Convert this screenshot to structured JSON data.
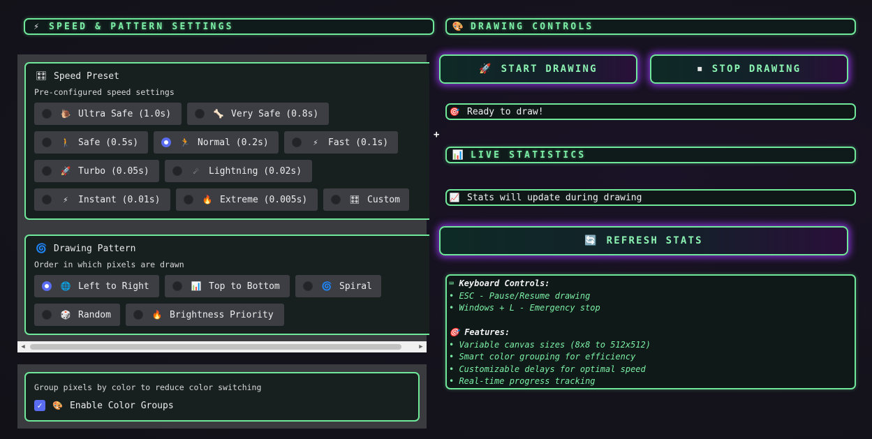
{
  "left_header": {
    "icon": "lightning-icon",
    "title": "SPEED & PATTERN SETTINGS"
  },
  "right_header": {
    "icon": "palette-icon",
    "title": "DRAWING CONTROLS"
  },
  "speed_preset": {
    "icon": "dice-icon",
    "title": "Speed Preset",
    "description": "Pre-configured speed settings",
    "selected": "Normal (0.2s)",
    "options": [
      {
        "label": "Ultra Safe (1.0s)",
        "icon": "snail-icon",
        "glyph": "🐌"
      },
      {
        "label": "Very Safe (0.8s)",
        "icon": "bone-icon",
        "glyph": "🦴"
      },
      {
        "label": "Safe (0.5s)",
        "icon": "walking-icon",
        "glyph": "🚶"
      },
      {
        "label": "Normal (0.2s)",
        "icon": "running-icon",
        "glyph": "🏃"
      },
      {
        "label": "Fast (0.1s)",
        "icon": "lightning-icon",
        "glyph": "⚡"
      },
      {
        "label": "Turbo (0.05s)",
        "icon": "rocket-icon",
        "glyph": "🚀"
      },
      {
        "label": "Lightning (0.02s)",
        "icon": "comet-icon",
        "glyph": "☄"
      },
      {
        "label": "Instant (0.01s)",
        "icon": "lightning-icon",
        "glyph": "⚡"
      },
      {
        "label": "Extreme (0.005s)",
        "icon": "fire-icon",
        "glyph": "🔥"
      },
      {
        "label": "Custom",
        "icon": "dice-icon",
        "glyph": "🎛"
      }
    ]
  },
  "drawing_pattern": {
    "icon": "spiral-icon",
    "title": "Drawing Pattern",
    "description": "Order in which pixels are drawn",
    "selected": "Left to Right",
    "options": [
      {
        "label": "Left to Right",
        "icon": "globe-icon",
        "glyph": "🌐"
      },
      {
        "label": "Top to Bottom",
        "icon": "bar-chart-icon",
        "glyph": "📊"
      },
      {
        "label": "Spiral",
        "icon": "spiral-icon",
        "glyph": "🌀"
      },
      {
        "label": "Random",
        "icon": "dice-icon",
        "glyph": "🎲"
      },
      {
        "label": "Brightness Priority",
        "icon": "fire-icon",
        "glyph": "🔥"
      }
    ]
  },
  "color_groups": {
    "description": "Group pixels by color to reduce color switching",
    "checkbox_label": "Enable Color Groups",
    "checked": true,
    "icon": "palette-icon"
  },
  "controls": {
    "start_label": "START DRAWING",
    "start_icon": "rocket-icon",
    "stop_label": "STOP DRAWING",
    "stop_icon": "stop-square-icon",
    "status_text": "Ready to draw!",
    "status_icon": "target-icon"
  },
  "statistics": {
    "header": "LIVE STATISTICS",
    "header_icon": "bar-chart-icon",
    "status_text": "Stats will update during drawing",
    "status_icon": "trend-chart-icon",
    "refresh_label": "REFRESH STATS",
    "refresh_icon": "refresh-icon"
  },
  "info": {
    "keyboard_heading": "Keyboard Controls:",
    "keyboard_icon": "keyboard-icon",
    "keyboard_lines": [
      "• ESC - Pause/Resume drawing",
      "• Windows + L - Emergency stop"
    ],
    "features_heading": "Features:",
    "features_icon": "target-icon",
    "features_lines": [
      "• Variable canvas sizes (8x8 to 512x512)",
      "• Smart color grouping for efficiency",
      "• Customizable delays for optimal speed",
      "• Real-time progress tracking"
    ]
  },
  "colors": {
    "accent_green": "#6fe89a",
    "accent_purple": "#a03cff",
    "radio_selected": "#5a6cf0"
  }
}
